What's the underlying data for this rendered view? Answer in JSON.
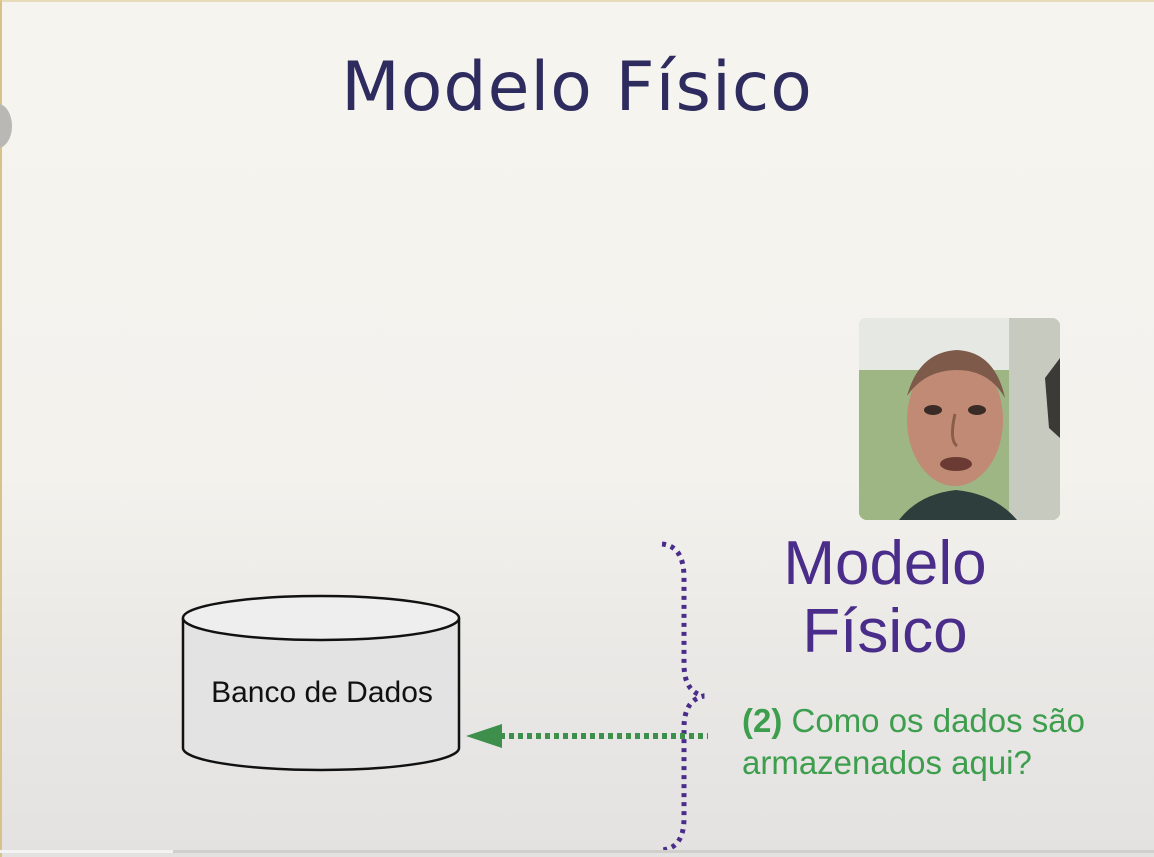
{
  "slide": {
    "title": "Modelo Físico",
    "database_label": "Banco de Dados",
    "model_label_line1": "Modelo",
    "model_label_line2": "Físico",
    "question_number": "(2)",
    "question_text": " Como os dados são armazenados aqui?"
  },
  "colors": {
    "title": "#2e2b5f",
    "brace": "#4a2d8a",
    "arrow": "#3d8f4b",
    "question": "#3d9e4d"
  },
  "video": {
    "progress_fraction": 0.15
  }
}
